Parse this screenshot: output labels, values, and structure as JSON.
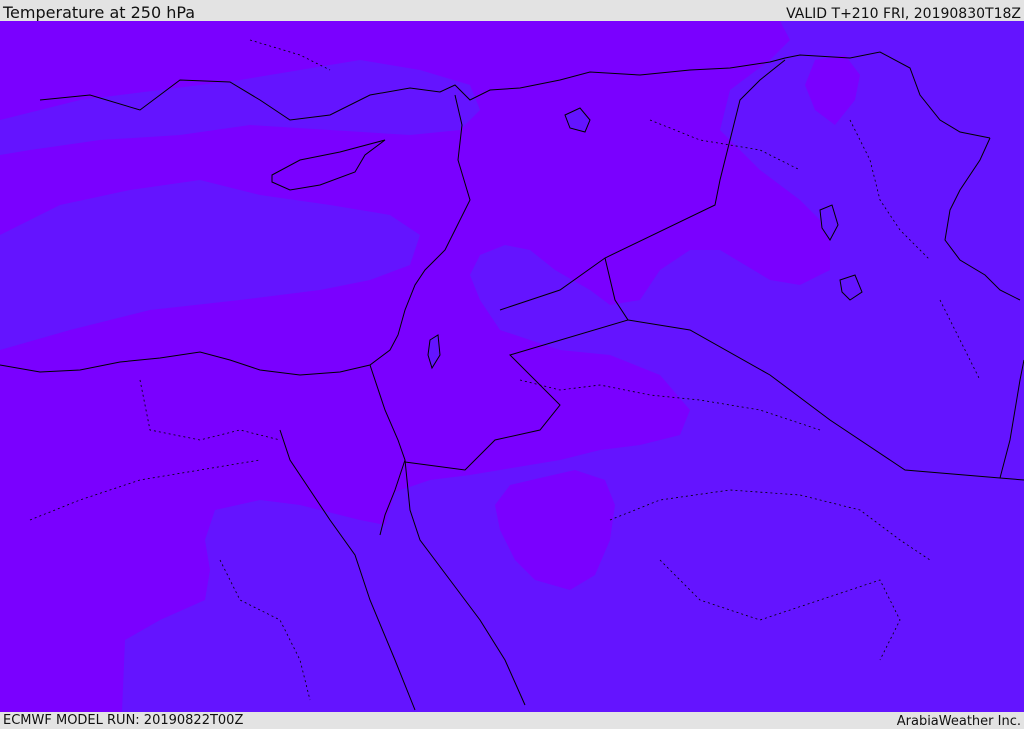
{
  "header": {
    "title": "Temperature at 250 hPa",
    "valid_time": "VALID T+210 FRI, 20190830T18Z"
  },
  "footer": {
    "model_run": "ECMWF MODEL RUN: 20190822T00Z",
    "credit": "ArabiaWeather Inc."
  },
  "colors": {
    "band_light": "#6414ff",
    "band_dark": "#7a00ff",
    "bar_background": "#e3e3e3",
    "coastline": "#000000"
  }
}
